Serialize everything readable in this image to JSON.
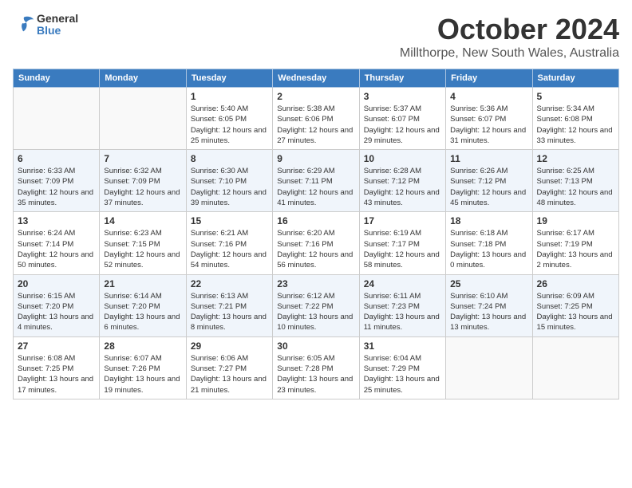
{
  "logo": {
    "general": "General",
    "blue": "Blue"
  },
  "title": {
    "month": "October 2024",
    "location": "Millthorpe, New South Wales, Australia"
  },
  "headers": [
    "Sunday",
    "Monday",
    "Tuesday",
    "Wednesday",
    "Thursday",
    "Friday",
    "Saturday"
  ],
  "weeks": [
    [
      {
        "day": "",
        "info": ""
      },
      {
        "day": "",
        "info": ""
      },
      {
        "day": "1",
        "info": "Sunrise: 5:40 AM\nSunset: 6:05 PM\nDaylight: 12 hours and 25 minutes."
      },
      {
        "day": "2",
        "info": "Sunrise: 5:38 AM\nSunset: 6:06 PM\nDaylight: 12 hours and 27 minutes."
      },
      {
        "day": "3",
        "info": "Sunrise: 5:37 AM\nSunset: 6:07 PM\nDaylight: 12 hours and 29 minutes."
      },
      {
        "day": "4",
        "info": "Sunrise: 5:36 AM\nSunset: 6:07 PM\nDaylight: 12 hours and 31 minutes."
      },
      {
        "day": "5",
        "info": "Sunrise: 5:34 AM\nSunset: 6:08 PM\nDaylight: 12 hours and 33 minutes."
      }
    ],
    [
      {
        "day": "6",
        "info": "Sunrise: 6:33 AM\nSunset: 7:09 PM\nDaylight: 12 hours and 35 minutes."
      },
      {
        "day": "7",
        "info": "Sunrise: 6:32 AM\nSunset: 7:09 PM\nDaylight: 12 hours and 37 minutes."
      },
      {
        "day": "8",
        "info": "Sunrise: 6:30 AM\nSunset: 7:10 PM\nDaylight: 12 hours and 39 minutes."
      },
      {
        "day": "9",
        "info": "Sunrise: 6:29 AM\nSunset: 7:11 PM\nDaylight: 12 hours and 41 minutes."
      },
      {
        "day": "10",
        "info": "Sunrise: 6:28 AM\nSunset: 7:12 PM\nDaylight: 12 hours and 43 minutes."
      },
      {
        "day": "11",
        "info": "Sunrise: 6:26 AM\nSunset: 7:12 PM\nDaylight: 12 hours and 45 minutes."
      },
      {
        "day": "12",
        "info": "Sunrise: 6:25 AM\nSunset: 7:13 PM\nDaylight: 12 hours and 48 minutes."
      }
    ],
    [
      {
        "day": "13",
        "info": "Sunrise: 6:24 AM\nSunset: 7:14 PM\nDaylight: 12 hours and 50 minutes."
      },
      {
        "day": "14",
        "info": "Sunrise: 6:23 AM\nSunset: 7:15 PM\nDaylight: 12 hours and 52 minutes."
      },
      {
        "day": "15",
        "info": "Sunrise: 6:21 AM\nSunset: 7:16 PM\nDaylight: 12 hours and 54 minutes."
      },
      {
        "day": "16",
        "info": "Sunrise: 6:20 AM\nSunset: 7:16 PM\nDaylight: 12 hours and 56 minutes."
      },
      {
        "day": "17",
        "info": "Sunrise: 6:19 AM\nSunset: 7:17 PM\nDaylight: 12 hours and 58 minutes."
      },
      {
        "day": "18",
        "info": "Sunrise: 6:18 AM\nSunset: 7:18 PM\nDaylight: 13 hours and 0 minutes."
      },
      {
        "day": "19",
        "info": "Sunrise: 6:17 AM\nSunset: 7:19 PM\nDaylight: 13 hours and 2 minutes."
      }
    ],
    [
      {
        "day": "20",
        "info": "Sunrise: 6:15 AM\nSunset: 7:20 PM\nDaylight: 13 hours and 4 minutes."
      },
      {
        "day": "21",
        "info": "Sunrise: 6:14 AM\nSunset: 7:20 PM\nDaylight: 13 hours and 6 minutes."
      },
      {
        "day": "22",
        "info": "Sunrise: 6:13 AM\nSunset: 7:21 PM\nDaylight: 13 hours and 8 minutes."
      },
      {
        "day": "23",
        "info": "Sunrise: 6:12 AM\nSunset: 7:22 PM\nDaylight: 13 hours and 10 minutes."
      },
      {
        "day": "24",
        "info": "Sunrise: 6:11 AM\nSunset: 7:23 PM\nDaylight: 13 hours and 11 minutes."
      },
      {
        "day": "25",
        "info": "Sunrise: 6:10 AM\nSunset: 7:24 PM\nDaylight: 13 hours and 13 minutes."
      },
      {
        "day": "26",
        "info": "Sunrise: 6:09 AM\nSunset: 7:25 PM\nDaylight: 13 hours and 15 minutes."
      }
    ],
    [
      {
        "day": "27",
        "info": "Sunrise: 6:08 AM\nSunset: 7:25 PM\nDaylight: 13 hours and 17 minutes."
      },
      {
        "day": "28",
        "info": "Sunrise: 6:07 AM\nSunset: 7:26 PM\nDaylight: 13 hours and 19 minutes."
      },
      {
        "day": "29",
        "info": "Sunrise: 6:06 AM\nSunset: 7:27 PM\nDaylight: 13 hours and 21 minutes."
      },
      {
        "day": "30",
        "info": "Sunrise: 6:05 AM\nSunset: 7:28 PM\nDaylight: 13 hours and 23 minutes."
      },
      {
        "day": "31",
        "info": "Sunrise: 6:04 AM\nSunset: 7:29 PM\nDaylight: 13 hours and 25 minutes."
      },
      {
        "day": "",
        "info": ""
      },
      {
        "day": "",
        "info": ""
      }
    ]
  ]
}
